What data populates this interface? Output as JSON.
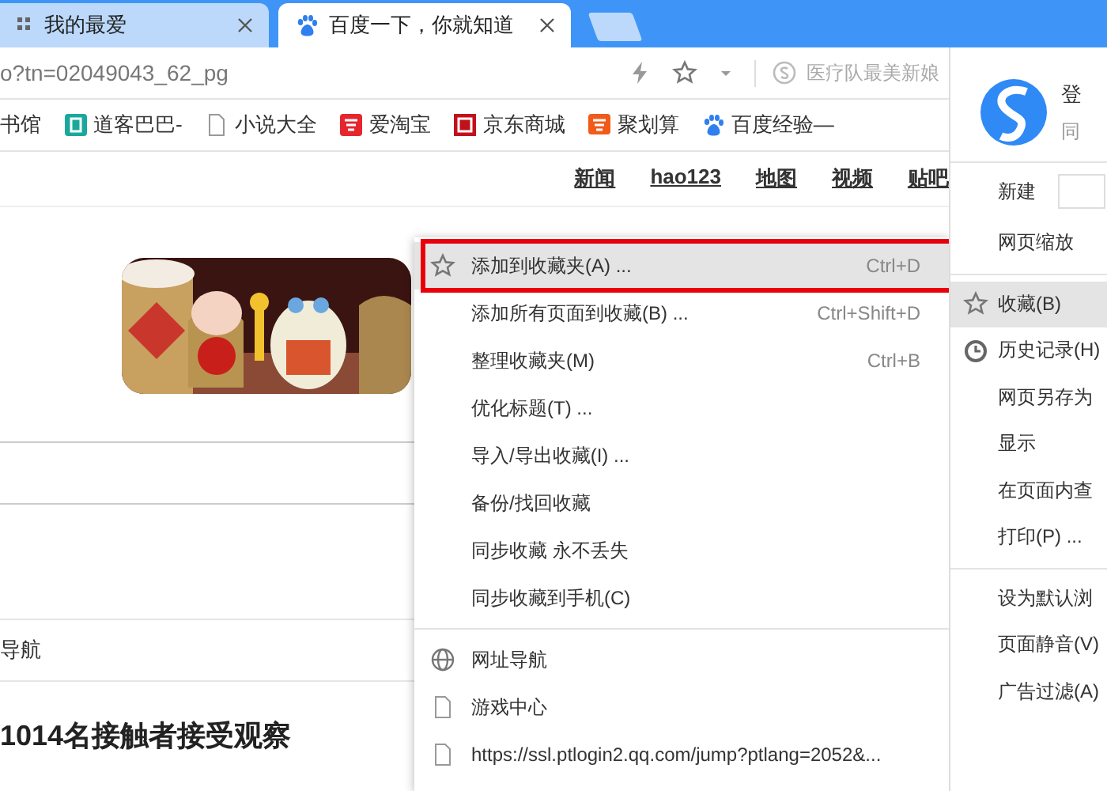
{
  "tabs": [
    {
      "title": "我的最爱",
      "selected": false
    },
    {
      "title": "百度一下，你就知道",
      "selected": true
    }
  ],
  "address_bar": {
    "url": "o?tn=02049043_62_pg",
    "search_hint": "医疗队最美新娘"
  },
  "bookmarks": [
    "书馆",
    "道客巴巴-",
    "小说大全",
    "爱淘宝",
    "京东商城",
    "聚划算",
    "百度经验—"
  ],
  "page": {
    "nav_links": [
      "新闻",
      "hao123",
      "地图",
      "视频",
      "贴吧"
    ],
    "nav_label": "导航",
    "headline": "1014名接触者接受观察"
  },
  "bookmark_menu": {
    "groups": [
      [
        {
          "label": "添加到收藏夹(A) ...",
          "shortcut": "Ctrl+D",
          "selected": true
        },
        {
          "label": "添加所有页面到收藏(B) ...",
          "shortcut": "Ctrl+Shift+D",
          "selected": false
        },
        {
          "label": "整理收藏夹(M)",
          "shortcut": "Ctrl+B",
          "selected": false
        },
        {
          "label": "优化标题(T) ...",
          "selected": false
        },
        {
          "label": "导入/导出收藏(I) ...",
          "selected": false
        },
        {
          "label": "备份/找回收藏",
          "selected": false
        },
        {
          "label": "同步收藏 永不丢失",
          "selected": false
        },
        {
          "label": "同步收藏到手机(C)",
          "selected": false
        }
      ],
      [
        {
          "label": "网址导航",
          "selected": false
        },
        {
          "label": "游戏中心",
          "selected": false
        },
        {
          "label": "https://ssl.ptlogin2.qq.com/jump?ptlang=2052&...",
          "selected": false
        }
      ]
    ]
  },
  "main_menu": {
    "login": "登",
    "login_sub": "同",
    "groups": [
      [
        {
          "label": "新建",
          "selected": false
        },
        {
          "label": "网页缩放",
          "selected": false
        }
      ],
      [
        {
          "label": "收藏(B)",
          "selected": true
        },
        {
          "label": "历史记录(H)",
          "selected": false
        },
        {
          "label": "网页另存为",
          "selected": false
        },
        {
          "label": "显示",
          "selected": false
        },
        {
          "label": "在页面内查",
          "selected": false
        },
        {
          "label": "打印(P) ...",
          "selected": false
        }
      ],
      [
        {
          "label": "设为默认浏",
          "selected": false
        },
        {
          "label": "页面静音(V)",
          "selected": false
        },
        {
          "label": "广告过滤(A)",
          "selected": false
        }
      ]
    ]
  }
}
